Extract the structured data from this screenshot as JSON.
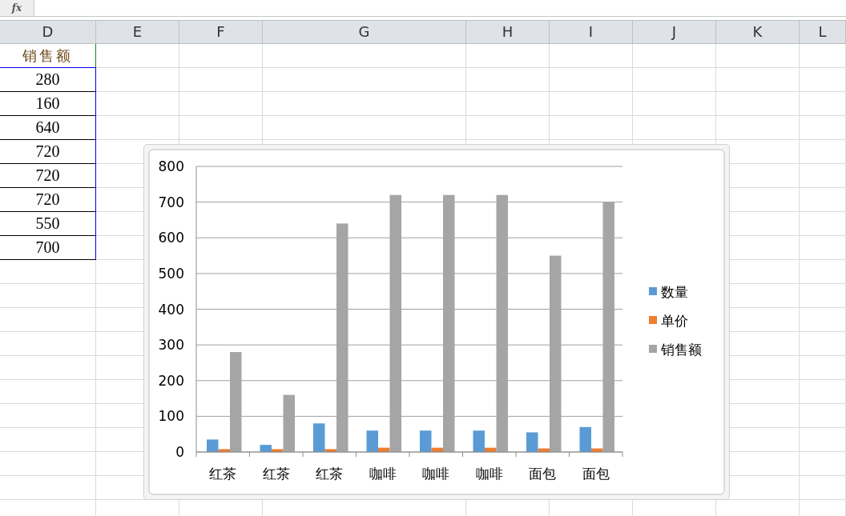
{
  "formula_bar": {
    "function_label": "fx"
  },
  "columns": [
    "D",
    "E",
    "F",
    "G",
    "H",
    "I",
    "J",
    "K",
    "L"
  ],
  "column_d": {
    "header": "销售额",
    "values": [
      "280",
      "160",
      "640",
      "720",
      "720",
      "720",
      "550",
      "700"
    ]
  },
  "chart": {
    "chart_data": {
      "type": "bar",
      "categories": [
        "红茶",
        "红茶",
        "红茶",
        "咖啡",
        "咖啡",
        "咖啡",
        "面包",
        "面包"
      ],
      "series": [
        {
          "name": "数量",
          "color": "#5b9bd5",
          "values": [
            35,
            20,
            80,
            60,
            60,
            60,
            55,
            70
          ]
        },
        {
          "name": "单价",
          "color": "#ed7d31",
          "values": [
            8,
            8,
            8,
            12,
            12,
            12,
            10,
            10
          ]
        },
        {
          "name": "销售额",
          "color": "#a5a5a5",
          "values": [
            280,
            160,
            640,
            720,
            720,
            720,
            550,
            700
          ]
        }
      ],
      "grid": true,
      "legend": true,
      "ylim": [
        0,
        800
      ],
      "yticks": [
        0,
        100,
        200,
        300,
        400,
        500,
        600,
        700,
        800
      ]
    }
  }
}
